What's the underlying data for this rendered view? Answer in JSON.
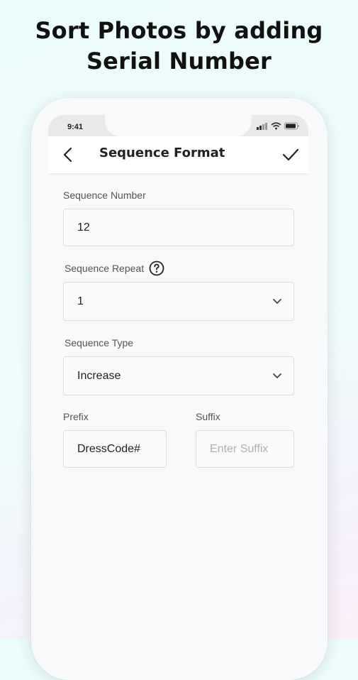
{
  "headline": {
    "line1": "Sort Photos by adding",
    "line2": "Serial Number"
  },
  "status_bar": {
    "time": "9:41"
  },
  "app_bar": {
    "title": "Sequence Format"
  },
  "form": {
    "sequence_number": {
      "label": "Sequence Number",
      "value": "12"
    },
    "sequence_repeat": {
      "label": "Sequence Repeat",
      "value": "1"
    },
    "sequence_type": {
      "label": "Sequence Type",
      "value": "Increase"
    },
    "prefix": {
      "label": "Prefix",
      "value": "DressCode#"
    },
    "suffix": {
      "label": "Suffix",
      "value": "",
      "placeholder": "Enter Suffix"
    }
  },
  "icons": {
    "back": "arrow-left-icon",
    "confirm": "check-icon",
    "help": "question-circle-icon",
    "dropdown": "chevron-down-icon"
  },
  "colors": {
    "background": "#eafcfb",
    "text": "#222222",
    "field_border": "#dcdcdc"
  }
}
